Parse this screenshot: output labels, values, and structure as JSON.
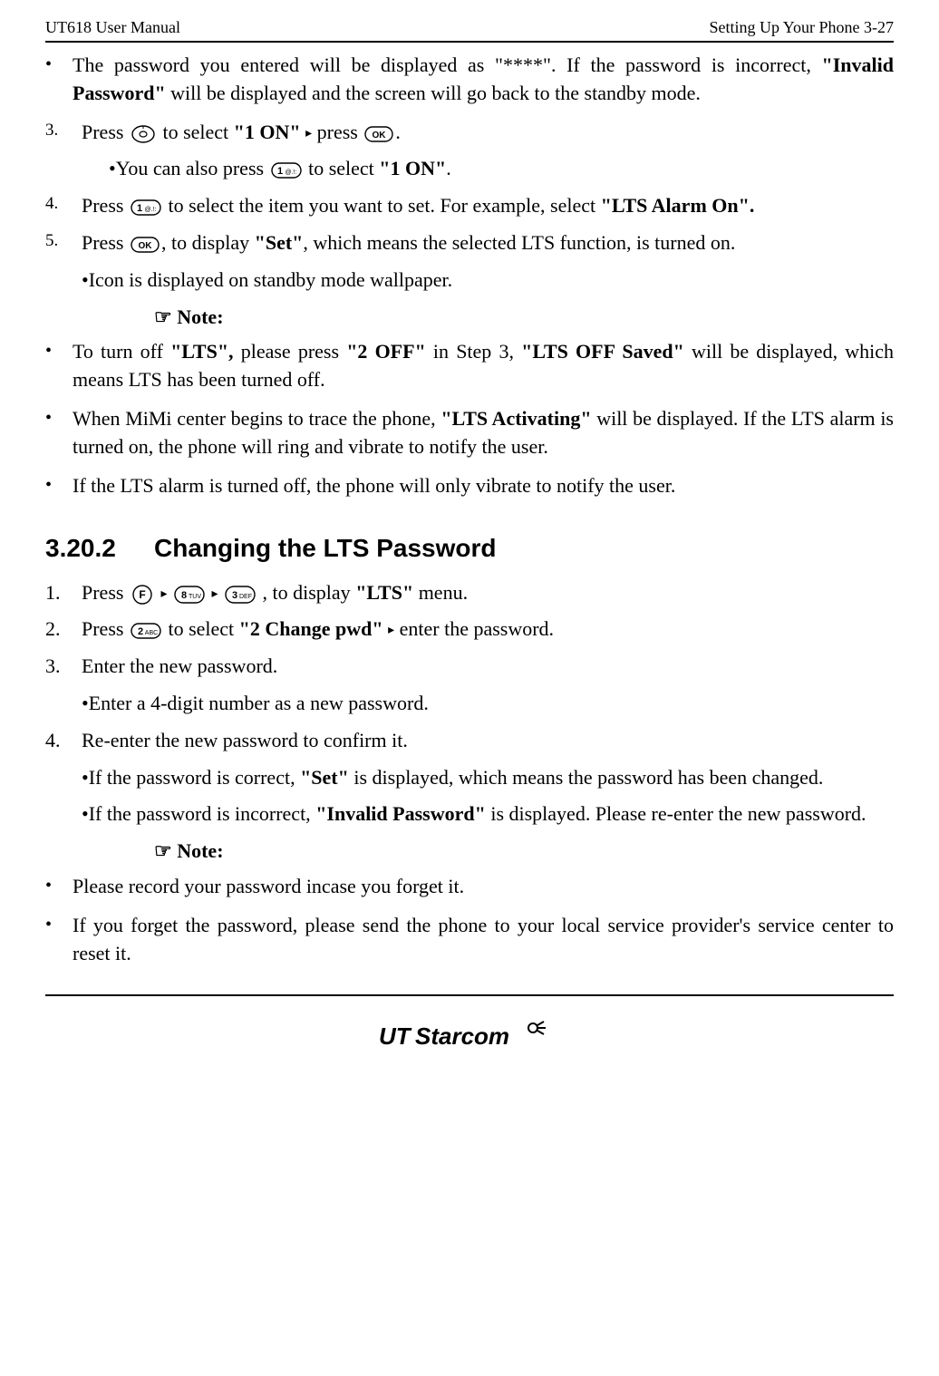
{
  "header": {
    "left": "UT618 User Manual",
    "right": "Setting Up Your Phone   3-27"
  },
  "topBullets": [
    {
      "pre": "The password you entered will be displayed as \"****\". If the password is incorrect, ",
      "bold1": "\"Invalid Password\"",
      "post": " will be displayed and the screen will go back to the standby mode."
    }
  ],
  "steps1": [
    {
      "num": "3.",
      "parts": {
        "p1": "Press ",
        "p2": " to select ",
        "b1": "\"1 ON\"",
        "p3": " press ",
        "p4": "."
      },
      "sub": {
        "p1": "You can also press ",
        "p2": " to select ",
        "b1": "\"1 ON\"",
        "p3": "."
      }
    },
    {
      "num": "4.",
      "parts": {
        "p1": "Press ",
        "p2": " to select the item you want to set. For example, select ",
        "b1": "\"LTS Alarm On\".",
        "p3": ""
      }
    },
    {
      "num": "5.",
      "parts": {
        "p1": "Press ",
        "p2": ", to display ",
        "b1": "\"Set\"",
        "p3": ", which means the selected LTS function, is turned on."
      },
      "sub2": "Icon is displayed on standby mode wallpaper."
    }
  ],
  "noteLabel": "☞ Note:",
  "noteBullets1": [
    {
      "p1": "To turn off ",
      "b1": "\"LTS\",",
      "p2": " please press ",
      "b2": "\"2 OFF\"",
      "p3": " in Step 3, ",
      "b3": "\"LTS OFF Saved\"",
      "p4": " will be displayed, which means LTS has been turned off."
    },
    {
      "p1": "When MiMi center begins to trace the phone, ",
      "b1": "\"LTS Activating\"",
      "p2": " will be displayed. If the LTS alarm is turned on, the phone will ring and vibrate to notify the user."
    },
    {
      "p1": "If the LTS alarm is turned off, the phone will only vibrate to notify the user."
    }
  ],
  "section": {
    "num": "3.20.2",
    "title": "Changing the LTS Password"
  },
  "steps2": [
    {
      "num": "1.",
      "p1": "Press ",
      "p2": ", to display ",
      "b1": "\"LTS\"",
      "p3": " menu."
    },
    {
      "num": "2.",
      "p1": "Press ",
      "p2": " to select ",
      "b1": "\"2 Change pwd\"",
      "p3": " enter the password."
    },
    {
      "num": "3.",
      "p1": "Enter the new password.",
      "sub": "Enter a 4-digit number as a new password."
    },
    {
      "num": "4.",
      "p1": "Re-enter the new password to confirm it.",
      "subBullets": [
        {
          "p1": "If the password is correct, ",
          "b1": "\"Set\"",
          "p2": " is displayed, which means the password has been changed."
        },
        {
          "p1": "If the password is incorrect, ",
          "b1": "\"Invalid Password\"",
          "p2": " is displayed. Please re-enter the new password."
        }
      ]
    }
  ],
  "noteBullets2": [
    "Please record your password incase you forget it.",
    "If you forget the password, please send the phone to your local service provider's service center to reset it."
  ],
  "logo": {
    "text": "UTStarcom"
  },
  "icons": {
    "tri": "▸"
  }
}
